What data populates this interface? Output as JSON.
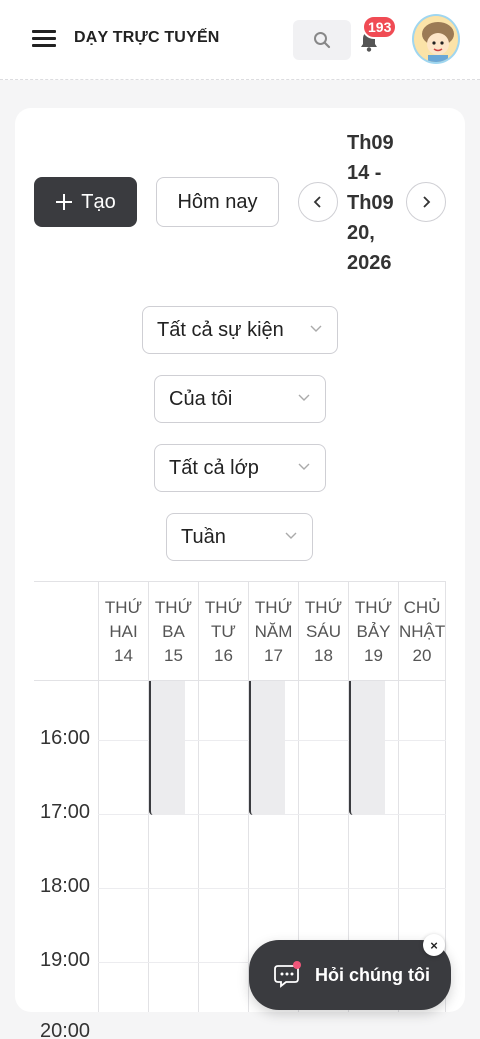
{
  "header": {
    "brand": "DẠY TRỰC TUYẾN",
    "notification_count": "193",
    "icons": [
      "menu-icon",
      "search-icon",
      "bell-icon",
      "avatar"
    ]
  },
  "toolbar": {
    "create_label": "Tạo",
    "today_label": "Hôm nay",
    "date_range": "Th09 14 - Th09 20, 2026"
  },
  "filters": {
    "events": "Tất cả sự kiện",
    "owner": "Của tôi",
    "classes": "Tất cả lớp",
    "view": "Tuần"
  },
  "calendar": {
    "days": [
      {
        "label1": "THỨ",
        "label2": "HAI",
        "date": "14"
      },
      {
        "label1": "THỨ",
        "label2": "BA",
        "date": "15"
      },
      {
        "label1": "THỨ",
        "label2": "TƯ",
        "date": "16"
      },
      {
        "label1": "THỨ",
        "label2": "NĂM",
        "date": "17"
      },
      {
        "label1": "THỨ",
        "label2": "SÁU",
        "date": "18"
      },
      {
        "label1": "THỨ",
        "label2": "BẢY",
        "date": "19"
      },
      {
        "label1": "CHỦ",
        "label2": "NHẬT",
        "date": "20"
      }
    ],
    "times": [
      "16:00",
      "17:00",
      "18:00",
      "19:00",
      "20:00"
    ]
  },
  "chat": {
    "label": "Hỏi chúng tôi",
    "close": "×"
  },
  "colors": {
    "primary_dark": "#3a3b3f",
    "badge_red": "#f04b54",
    "busy_fill": "#ececee"
  }
}
